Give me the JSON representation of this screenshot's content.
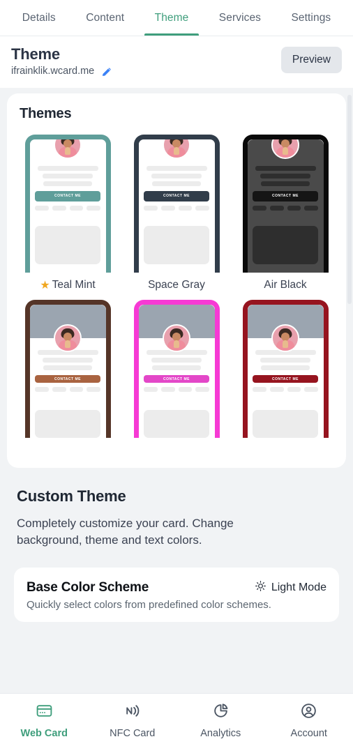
{
  "tabs": [
    {
      "label": "Details",
      "active": false
    },
    {
      "label": "Content",
      "active": false
    },
    {
      "label": "Theme",
      "active": true
    },
    {
      "label": "Services",
      "active": false
    },
    {
      "label": "Settings",
      "active": false
    }
  ],
  "header": {
    "title": "Theme",
    "url": "ifrainklik.wcard.me",
    "edit_icon": "pencil-icon",
    "preview_label": "Preview"
  },
  "themes_section": {
    "heading": "Themes",
    "items": [
      {
        "name": "Teal Mint",
        "starred": true,
        "border": "#5f9e9a",
        "cta": "#5f9e9a",
        "cta_label": "CONTACT ME",
        "dark": false,
        "banner": false
      },
      {
        "name": "Space Gray",
        "starred": false,
        "border": "#313d4a",
        "cta": "#313d4a",
        "cta_label": "CONTACT ME",
        "dark": false,
        "banner": false
      },
      {
        "name": "Air Black",
        "starred": false,
        "border": "#0a0a0a",
        "cta": "#151515",
        "cta_label": "CONTACT ME",
        "dark": true,
        "banner": false
      },
      {
        "name": "",
        "starred": false,
        "border": "#553528",
        "cta": "#a96340",
        "cta_label": "CONTACT ME",
        "dark": false,
        "banner": true
      },
      {
        "name": "",
        "starred": false,
        "border": "#f63ad4",
        "cta": "#e347c8",
        "cta_label": "CONTACT ME",
        "dark": false,
        "banner": true
      },
      {
        "name": "",
        "starred": false,
        "border": "#96141f",
        "cta": "#96141f",
        "cta_label": "CONTACT ME",
        "dark": false,
        "banner": true
      }
    ]
  },
  "custom_theme": {
    "heading": "Custom Theme",
    "description": "Completely customize your card. Change background, theme and text colors."
  },
  "base_color_scheme": {
    "heading": "Base Color Scheme",
    "description": "Quickly select colors from predefined color schemes.",
    "mode_label": "Light Mode",
    "mode_icon": "sun-icon"
  },
  "bottom_nav": [
    {
      "label": "Web Card",
      "icon": "credit-card-icon",
      "active": true
    },
    {
      "label": "NFC Card",
      "icon": "nfc-icon",
      "active": false
    },
    {
      "label": "Analytics",
      "icon": "pie-chart-icon",
      "active": false
    },
    {
      "label": "Account",
      "icon": "user-circle-icon",
      "active": false
    }
  ],
  "colors": {
    "accent": "#3f9e7c",
    "star": "#f0a720",
    "page_bg": "#f1f3f5",
    "pencil": "#3b82f6"
  }
}
